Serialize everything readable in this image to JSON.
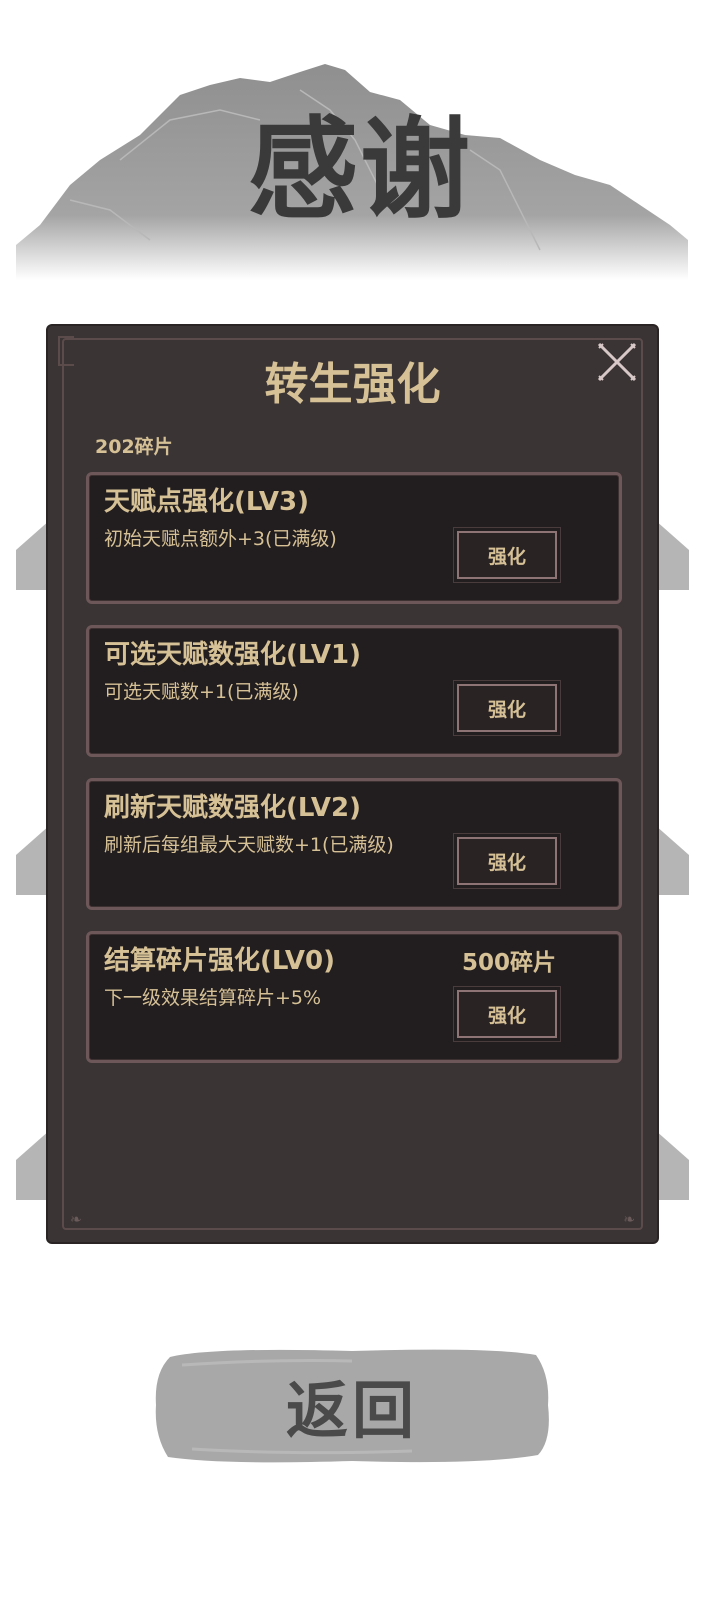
{
  "header": {
    "title": "感谢"
  },
  "panel": {
    "title": "转生强化",
    "shards": "202碎片",
    "close_icon": "close-x-icon",
    "cards": [
      {
        "name": "天赋点强化(LV3)",
        "desc": "初始天赋点额外+3(已满级)",
        "cost": "",
        "button": "强化"
      },
      {
        "name": "可选天赋数强化(LV1)",
        "desc": "可选天赋数+1(已满级)",
        "cost": "",
        "button": "强化"
      },
      {
        "name": "刷新天赋数强化(LV2)",
        "desc": "刷新后每组最大天赋数+1(已满级)",
        "cost": "",
        "button": "强化"
      },
      {
        "name": "结算碎片强化(LV0)",
        "desc": "下一级效果结算碎片+5%",
        "cost": "500碎片",
        "button": "强化"
      }
    ]
  },
  "footer": {
    "return_label": "返回"
  },
  "colors": {
    "gold_text": "#d6c196",
    "panel_bg": "#3a3434",
    "card_bg": "#221d1e",
    "card_border": "#6e5758"
  }
}
